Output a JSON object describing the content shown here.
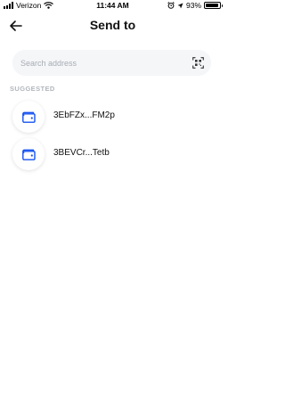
{
  "status_bar": {
    "carrier": "Verizon",
    "time": "11:44 AM",
    "battery": "93%",
    "battery_level": 0.93,
    "icons": [
      "signal-icon",
      "wifi-icon",
      "alarm-icon",
      "location-icon",
      "battery-icon"
    ]
  },
  "header": {
    "title": "Send to",
    "back_icon": "arrow-left-icon"
  },
  "search": {
    "placeholder": "Search address",
    "value": "",
    "scan_icon": "qr-scan-icon"
  },
  "suggested": {
    "label": "SUGGESTED",
    "items": [
      {
        "label": "3EbFZx...FM2p",
        "icon": "wallet-icon"
      },
      {
        "label": "3BEVCr...Tetb",
        "icon": "wallet-icon"
      }
    ]
  },
  "colors": {
    "accent": "#1652f0",
    "search_bg": "#f5f6f8",
    "muted_text": "#b2b6bc"
  }
}
